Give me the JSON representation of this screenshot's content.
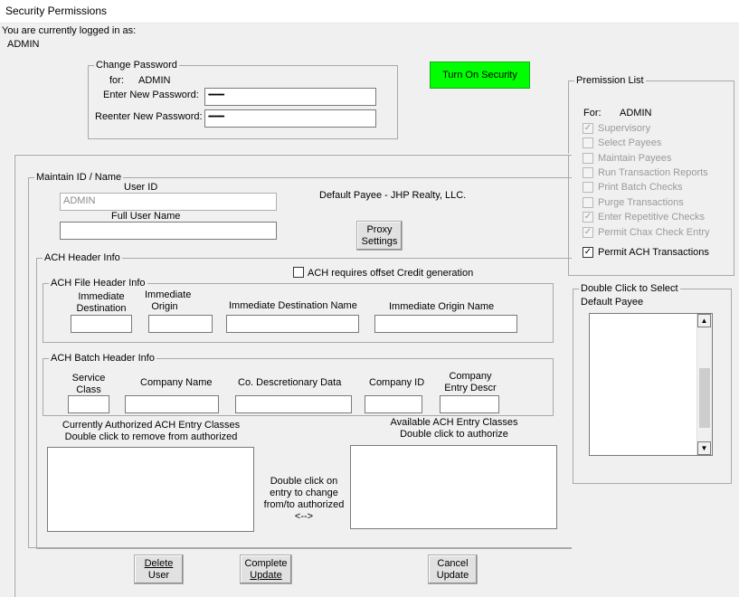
{
  "window": {
    "title": "Security Permissions"
  },
  "login": {
    "prompt": "You are currently logged in as:",
    "user": "ADMIN"
  },
  "change_password": {
    "legend": "Change Password",
    "for_label": "for:",
    "for_user": "ADMIN",
    "new_label": "Enter New Password:",
    "new_value": "••••••••••••",
    "reenter_label": "Reenter New Password:",
    "reenter_value": "••••••••••••"
  },
  "security_button": "Turn On Security",
  "permission_list": {
    "legend": "Premission List",
    "for_label": "For:",
    "for_user": "ADMIN",
    "items": [
      {
        "label": "Supervisory",
        "mark": "✓"
      },
      {
        "label": "Select Payees",
        "mark": ""
      },
      {
        "label": "Maintain Payees",
        "mark": ""
      },
      {
        "label": "Run Transaction Reports",
        "mark": ""
      },
      {
        "label": "Print Batch Checks",
        "mark": ""
      },
      {
        "label": "Purge Transactions",
        "mark": ""
      },
      {
        "label": "Enter Repetitive Checks",
        "mark": "✓"
      },
      {
        "label": "Permit Chax Check Entry",
        "mark": "✓"
      },
      {
        "label": "Permit ACH Transactions",
        "mark": "✓"
      }
    ]
  },
  "default_payee_box": {
    "legend": "Double Click to Select",
    "subtitle": "Default Payee"
  },
  "maintain": {
    "legend": "Maintain ID / Name",
    "user_id_label": "User ID",
    "user_id_value": "ADMIN",
    "full_name_label": "Full User Name",
    "full_name_value": "",
    "default_payee": "Default Payee - JHP Realty, LLC.",
    "proxy_button_1": "Proxy",
    "proxy_button_2": "Settings"
  },
  "ach_header": {
    "legend": "ACH Header Info",
    "offset_label": "ACH requires offset Credit generation",
    "offset_mark": "",
    "file_header": {
      "legend": "ACH File Header Info",
      "imm_dest_1": "Immediate",
      "imm_dest_2": "Destination",
      "imm_origin_1": "Immediate",
      "imm_origin_2": "Origin",
      "imm_dest_name": "Immediate Destination Name",
      "imm_origin_name": "Immediate Origin Name"
    },
    "batch_header": {
      "legend": "ACH Batch Header Info",
      "service_1": "Service",
      "service_2": "Class",
      "company_name": "Company Name",
      "discretionary": "Co. Descretionary Data",
      "company_id": "Company ID",
      "entry_descr_1": "Company",
      "entry_descr_2": "Entry Descr"
    },
    "authorized_1": "Currently Authorized ACH Entry Classes",
    "authorized_2": "Double click to remove from authorized",
    "available_1": "Available ACH Entry Classes",
    "available_2": "Double click to authorize",
    "middle_1": "Double click on",
    "middle_2": "entry to change",
    "middle_3": "from/to authorized",
    "middle_4": "<-->"
  },
  "buttons": {
    "delete_1": "Delete",
    "delete_2": "User",
    "complete_1": "Complete",
    "complete_2": "Update",
    "cancel_1": "Cancel",
    "cancel_2": "Update"
  },
  "icons": {
    "scroll_up": "▲",
    "scroll_down": "▼"
  }
}
